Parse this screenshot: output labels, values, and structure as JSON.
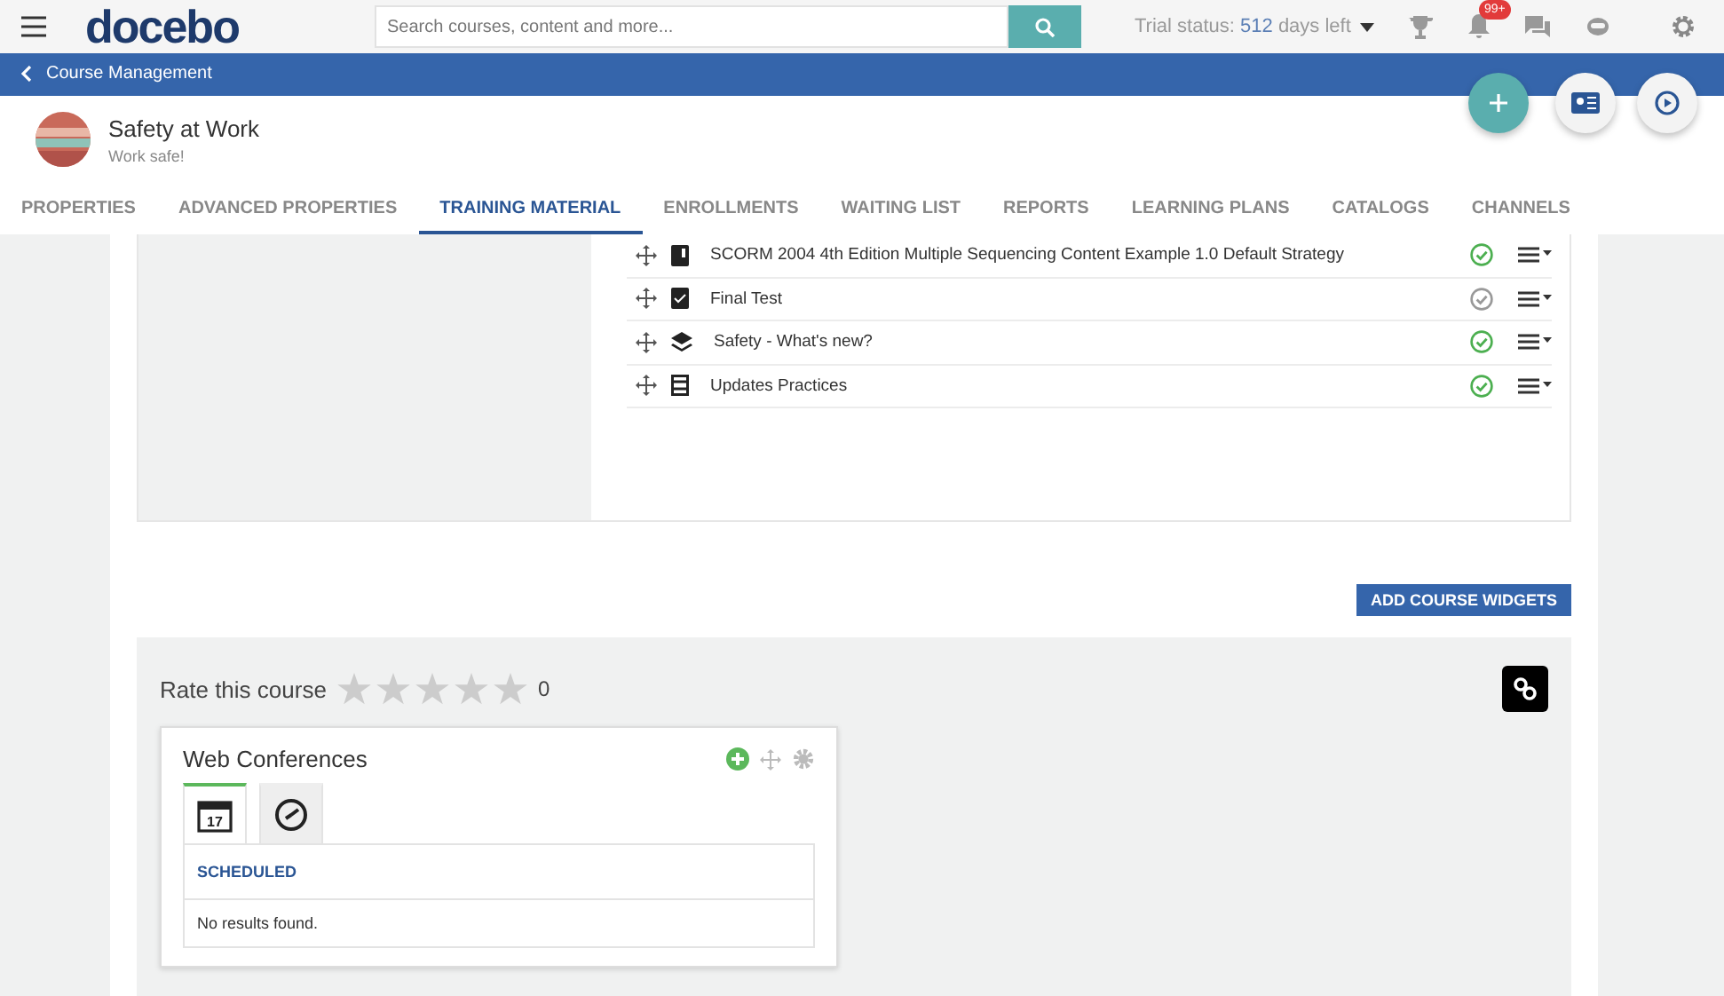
{
  "header": {
    "logo": "docebo",
    "search": {
      "placeholder": "Search courses, content and more..."
    },
    "trial": {
      "label": "Trial status:",
      "days": "512",
      "suffix": "days left"
    },
    "notifications_badge": "99+"
  },
  "breadcrumb": {
    "back": "Course Management"
  },
  "course": {
    "title": "Safety at Work",
    "subtitle": "Work safe!"
  },
  "tabs": [
    {
      "label": "PROPERTIES",
      "selected": false
    },
    {
      "label": "ADVANCED PROPERTIES",
      "selected": false
    },
    {
      "label": "TRAINING MATERIAL",
      "selected": true
    },
    {
      "label": "ENROLLMENTS",
      "selected": false
    },
    {
      "label": "WAITING LIST",
      "selected": false
    },
    {
      "label": "REPORTS",
      "selected": false
    },
    {
      "label": "LEARNING PLANS",
      "selected": false
    },
    {
      "label": "CATALOGS",
      "selected": false
    },
    {
      "label": "CHANNELS",
      "selected": false
    }
  ],
  "materials": [
    {
      "kind": "scorm",
      "title": "SCORM 2004 4th Edition Multiple Sequencing Content Example 1.0 Default Strategy",
      "completed": true
    },
    {
      "kind": "test",
      "title": "Final Test",
      "completed": false
    },
    {
      "kind": "layers",
      "title": "Safety - What's new?",
      "completed": true
    },
    {
      "kind": "video",
      "title": "Updates Practices",
      "completed": true
    }
  ],
  "add_widgets_button": "ADD COURSE WIDGETS",
  "rating": {
    "label": "Rate this course",
    "stars": 0,
    "count": "0"
  },
  "widget": {
    "title": "Web Conferences",
    "tabs": [
      {
        "kind": "calendar",
        "day": "17",
        "selected": true
      },
      {
        "kind": "clock",
        "selected": false
      }
    ],
    "section": "SCHEDULED",
    "empty": "No results found."
  }
}
